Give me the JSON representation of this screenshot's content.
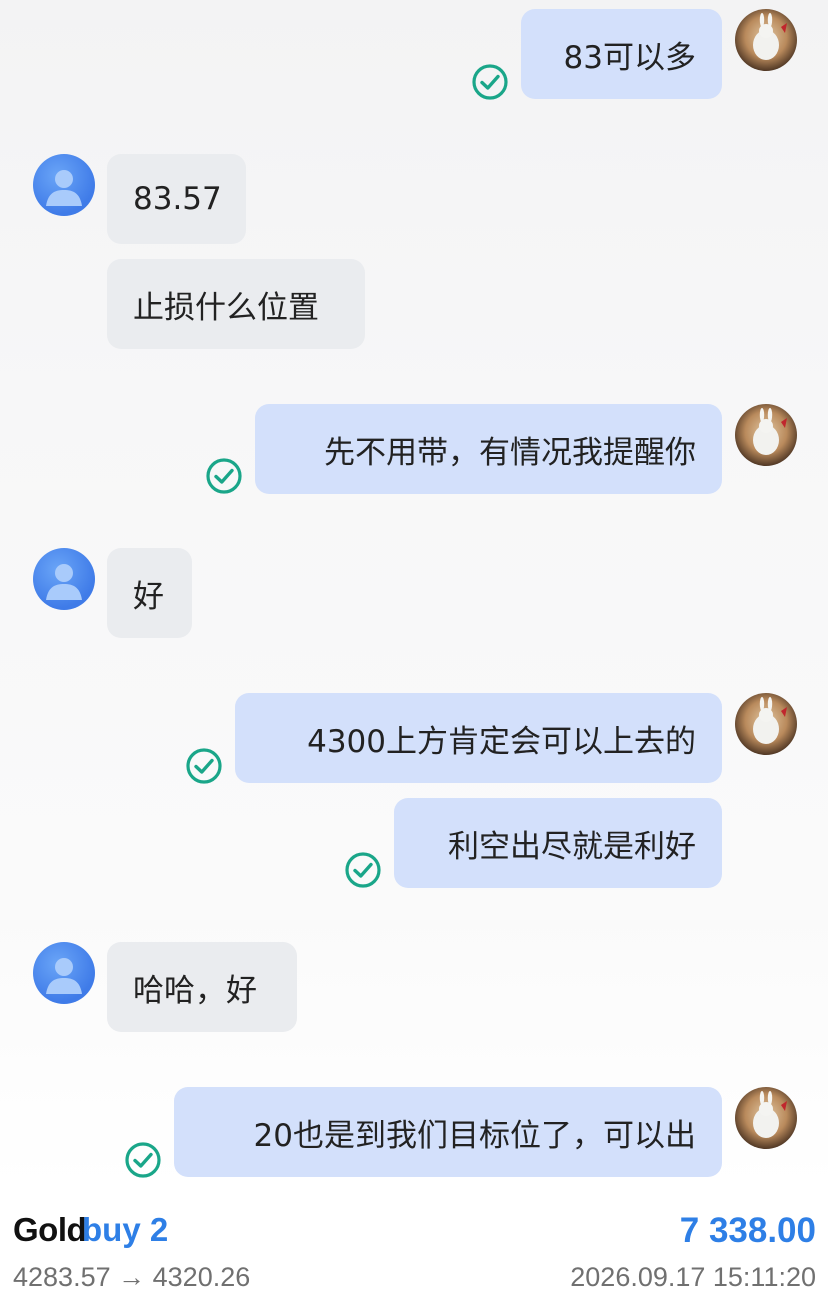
{
  "messages": [
    {
      "side": "out",
      "text": "83可以多",
      "read": true
    },
    {
      "side": "in",
      "text": "83.57"
    },
    {
      "side": "in",
      "text": "止损什么位置"
    },
    {
      "side": "out",
      "text": "先不用带，有情况我提醒你",
      "read": true
    },
    {
      "side": "in",
      "text": "好"
    },
    {
      "side": "out",
      "text": "4300上方肯定会可以上去的",
      "read": true
    },
    {
      "side": "out",
      "text": "利空出尽就是利好",
      "read": true
    },
    {
      "side": "in",
      "text": "哈哈，好"
    },
    {
      "side": "out",
      "text": "20也是到我们目标位了，可以出",
      "read": true
    }
  ],
  "trade": {
    "symbol": "Gold",
    "side_label": "buy 2",
    "profit": "7 338.00",
    "open_price": "4283.57",
    "arrow": "→",
    "close_price": "4320.26",
    "datetime": "2026.09.17 15:11:20"
  },
  "colors": {
    "accent": "#2e7fe6",
    "outgoing_bubble": "#d3e0fb",
    "incoming_bubble": "#eaecef",
    "read_check": "#1aa689"
  },
  "icons": {
    "read_receipt": "check-circle-icon",
    "user_avatar": "user-avatar",
    "self_avatar": "self-avatar"
  }
}
